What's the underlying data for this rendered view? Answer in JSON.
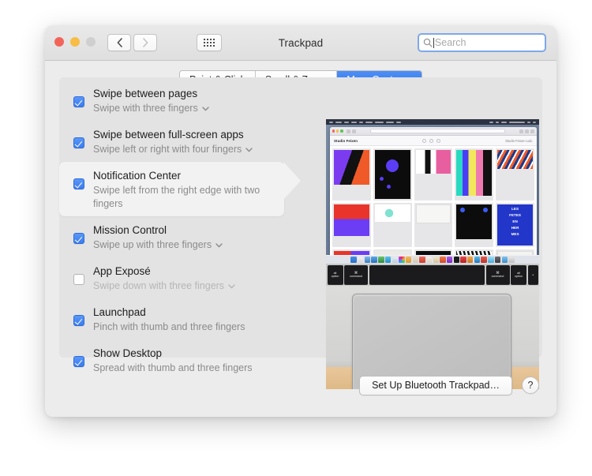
{
  "window": {
    "title": "Trackpad",
    "traffic_lights": [
      "close-red",
      "minimize-yellow",
      "zoom-grey-disabled"
    ],
    "nav": {
      "back_icon": "chevron-left-icon",
      "forward_icon": "chevron-right-icon",
      "grid_icon": "show-all-preferences-grid-icon"
    }
  },
  "search": {
    "placeholder": "Search",
    "value": "",
    "icon": "search-magnifier-icon",
    "focused": true
  },
  "tabs": [
    {
      "label": "Point & Click",
      "active": false
    },
    {
      "label": "Scroll & Zoom",
      "active": false
    },
    {
      "label": "More Gestures",
      "active": true
    }
  ],
  "gestures": [
    {
      "title": "Swipe between pages",
      "subtitle": "Swipe with three fingers",
      "checked": true,
      "has_dropdown": true,
      "highlighted": false,
      "disabled": false
    },
    {
      "title": "Swipe between full-screen apps",
      "subtitle": "Swipe left or right with four fingers",
      "checked": true,
      "has_dropdown": true,
      "highlighted": false,
      "disabled": false
    },
    {
      "title": "Notification Center",
      "subtitle": "Swipe left from the right edge with two fingers",
      "checked": true,
      "has_dropdown": false,
      "highlighted": true,
      "disabled": false
    },
    {
      "title": "Mission Control",
      "subtitle": "Swipe up with three fingers",
      "checked": true,
      "has_dropdown": true,
      "highlighted": false,
      "disabled": false
    },
    {
      "title": "App Exposé",
      "subtitle": "Swipe down with three fingers",
      "checked": false,
      "has_dropdown": true,
      "highlighted": false,
      "disabled": true
    },
    {
      "title": "Launchpad",
      "subtitle": "Pinch with thumb and three fingers",
      "checked": true,
      "has_dropdown": false,
      "highlighted": false,
      "disabled": false
    },
    {
      "title": "Show Desktop",
      "subtitle": "Spread with thumb and three fingers",
      "checked": true,
      "has_dropdown": false,
      "highlighted": false,
      "disabled": false
    }
  ],
  "preview": {
    "description": "MacBook photo: screen shows Safari design-portfolio gallery above dock, keyboard bottom row, and trackpad on desk",
    "safari": {
      "brand": "Studio Feixen",
      "account": "Studio Feixen Lab."
    },
    "keys": [
      {
        "top": "alt",
        "bottom": "option",
        "size": "sm"
      },
      {
        "top": "⌘",
        "bottom": "command",
        "size": "md"
      },
      {
        "top": "",
        "bottom": "",
        "size": "space"
      },
      {
        "top": "⌘",
        "bottom": "command",
        "size": "md"
      },
      {
        "top": "alt",
        "bottom": "option",
        "size": "sm"
      },
      {
        "top": "◂",
        "bottom": "",
        "size": "tiny"
      }
    ]
  },
  "footer": {
    "bluetooth_button": "Set Up Bluetooth Trackpad…",
    "help_button": "?"
  },
  "colors": {
    "accent_blue": "#3b7cf0",
    "window_chrome": "#ececec",
    "panel_bg": "#e3e3e3",
    "highlight_bg": "#f2f2f2",
    "subtitle_grey": "#8b8b8b",
    "disabled_grey": "#b6b6b6"
  }
}
